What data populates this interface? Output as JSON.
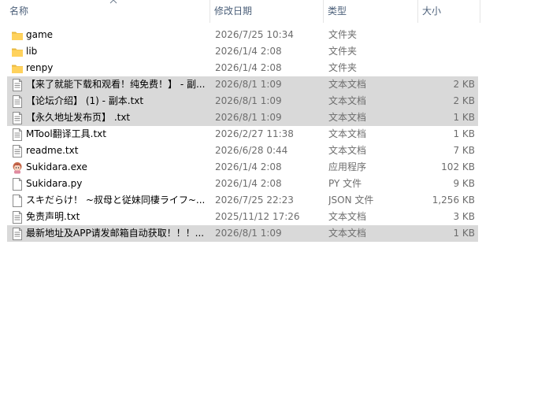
{
  "columns": {
    "name": "名称",
    "date": "修改日期",
    "type": "类型",
    "size": "大小"
  },
  "files": [
    {
      "name": "game",
      "date": "2026/7/25 10:34",
      "type": "文件夹",
      "size": "",
      "icon": "folder-icon",
      "selected": false
    },
    {
      "name": "lib",
      "date": "2026/1/4 2:08",
      "type": "文件夹",
      "size": "",
      "icon": "folder-icon",
      "selected": false
    },
    {
      "name": "renpy",
      "date": "2026/1/4 2:08",
      "type": "文件夹",
      "size": "",
      "icon": "folder-icon",
      "selected": false
    },
    {
      "name": "【来了就能下载和观看！纯免费！】 - 副...",
      "date": "2026/8/1 1:09",
      "type": "文本文档",
      "size": "2 KB",
      "icon": "text-file-icon",
      "selected": true
    },
    {
      "name": "【论坛介绍】 (1) - 副本.txt",
      "date": "2026/8/1 1:09",
      "type": "文本文档",
      "size": "2 KB",
      "icon": "text-file-icon",
      "selected": true
    },
    {
      "name": "【永久地址发布页】 .txt",
      "date": "2026/8/1 1:09",
      "type": "文本文档",
      "size": "1 KB",
      "icon": "text-file-icon",
      "selected": true
    },
    {
      "name": "MTool翻译工具.txt",
      "date": "2026/2/27 11:38",
      "type": "文本文档",
      "size": "1 KB",
      "icon": "text-file-icon",
      "selected": false
    },
    {
      "name": "readme.txt",
      "date": "2026/6/28 0:44",
      "type": "文本文档",
      "size": "7 KB",
      "icon": "text-file-icon",
      "selected": false
    },
    {
      "name": "Sukidara.exe",
      "date": "2026/1/4 2:08",
      "type": "应用程序",
      "size": "102 KB",
      "icon": "app-icon",
      "selected": false
    },
    {
      "name": "Sukidara.py",
      "date": "2026/1/4 2:08",
      "type": "PY 文件",
      "size": "9 KB",
      "icon": "blank-file-icon",
      "selected": false
    },
    {
      "name": "スキだらけ！ ~叔母と従妹同棲ライフ~...",
      "date": "2026/7/25 22:23",
      "type": "JSON 文件",
      "size": "1,256 KB",
      "icon": "blank-file-icon",
      "selected": false
    },
    {
      "name": "免责声明.txt",
      "date": "2025/11/12 17:26",
      "type": "文本文档",
      "size": "3 KB",
      "icon": "text-file-icon",
      "selected": false
    },
    {
      "name": "最新地址及APP请发邮箱自动获取！！！...",
      "date": "2026/8/1 1:09",
      "type": "文本文档",
      "size": "1 KB",
      "icon": "text-file-icon",
      "selected": true
    }
  ]
}
